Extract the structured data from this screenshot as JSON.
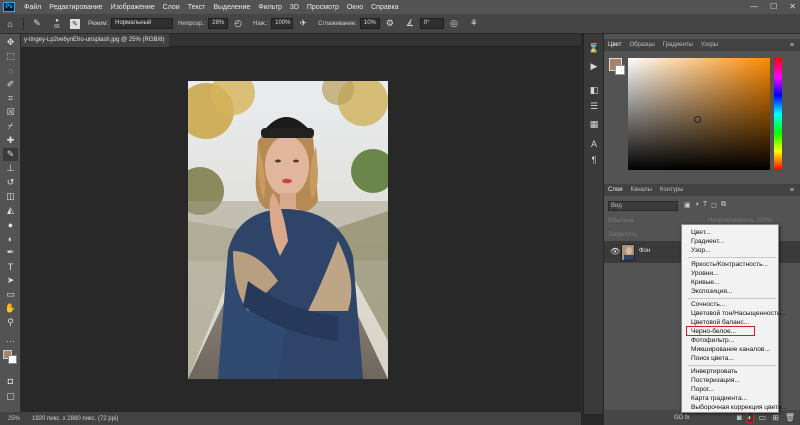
{
  "app": {
    "logo": "Ps"
  },
  "menubar": {
    "items": [
      "Файл",
      "Редактирование",
      "Изображение",
      "Слои",
      "Текст",
      "Выделение",
      "Фильтр",
      "3D",
      "Просмотр",
      "Окно",
      "Справка"
    ],
    "window_controls": [
      "—",
      "☐",
      "✕"
    ]
  },
  "options": {
    "brush_size": "65",
    "mode_label": "Режим:",
    "mode_value": "Нормальный",
    "opacity_label": "Непрозр.:",
    "opacity_value": "28%",
    "pressure_label": "Наж.:",
    "pressure_value": "100%",
    "smoothing_label": "Сглаживание:",
    "smoothing_value": "10%",
    "angle_value": "0°"
  },
  "document": {
    "tab_title": "y-tingey-Lp2ve6ynEho-unsplash.jpg @ 25% (RGB/8)",
    "close": "×"
  },
  "status": {
    "zoom": "25%",
    "info": "1920 пикс. x 2880 пикс. (72 ppi)"
  },
  "color_panel": {
    "tabs": [
      "Цвет",
      "Образцы",
      "Градиенты",
      "Узоры"
    ],
    "fg_color": "#a6836a",
    "bg_color": "#ffffff"
  },
  "layers_panel": {
    "tabs": [
      "Слои",
      "Каналы",
      "Контуры"
    ],
    "search_placeholder": "Вид",
    "dim_blend": "Обычные",
    "dim_opacity": "Непрозрачность: 100%",
    "dim_lock": "Закрепить:",
    "layer_name": "Фон",
    "bottom_label": "GO  fx"
  },
  "adjustment_menu": {
    "group1": [
      "Цвет...",
      "Градиент...",
      "Узор..."
    ],
    "group2": [
      "Яркость/Контрастность...",
      "Уровни...",
      "Кривые...",
      "Экспозиция..."
    ],
    "group3": [
      "Сочность...",
      "Цветовой тон/Насыщенность...",
      "Цветовой баланс...",
      "Черно-белое...",
      "Фотофильтр...",
      "Микширование каналов...",
      "Поиск цвета..."
    ],
    "group4": [
      "Инвертировать",
      "Постеризация...",
      "Порог...",
      "Карта градиента...",
      "Выборочная коррекция цвета..."
    ],
    "highlighted": "Черно-белое..."
  }
}
